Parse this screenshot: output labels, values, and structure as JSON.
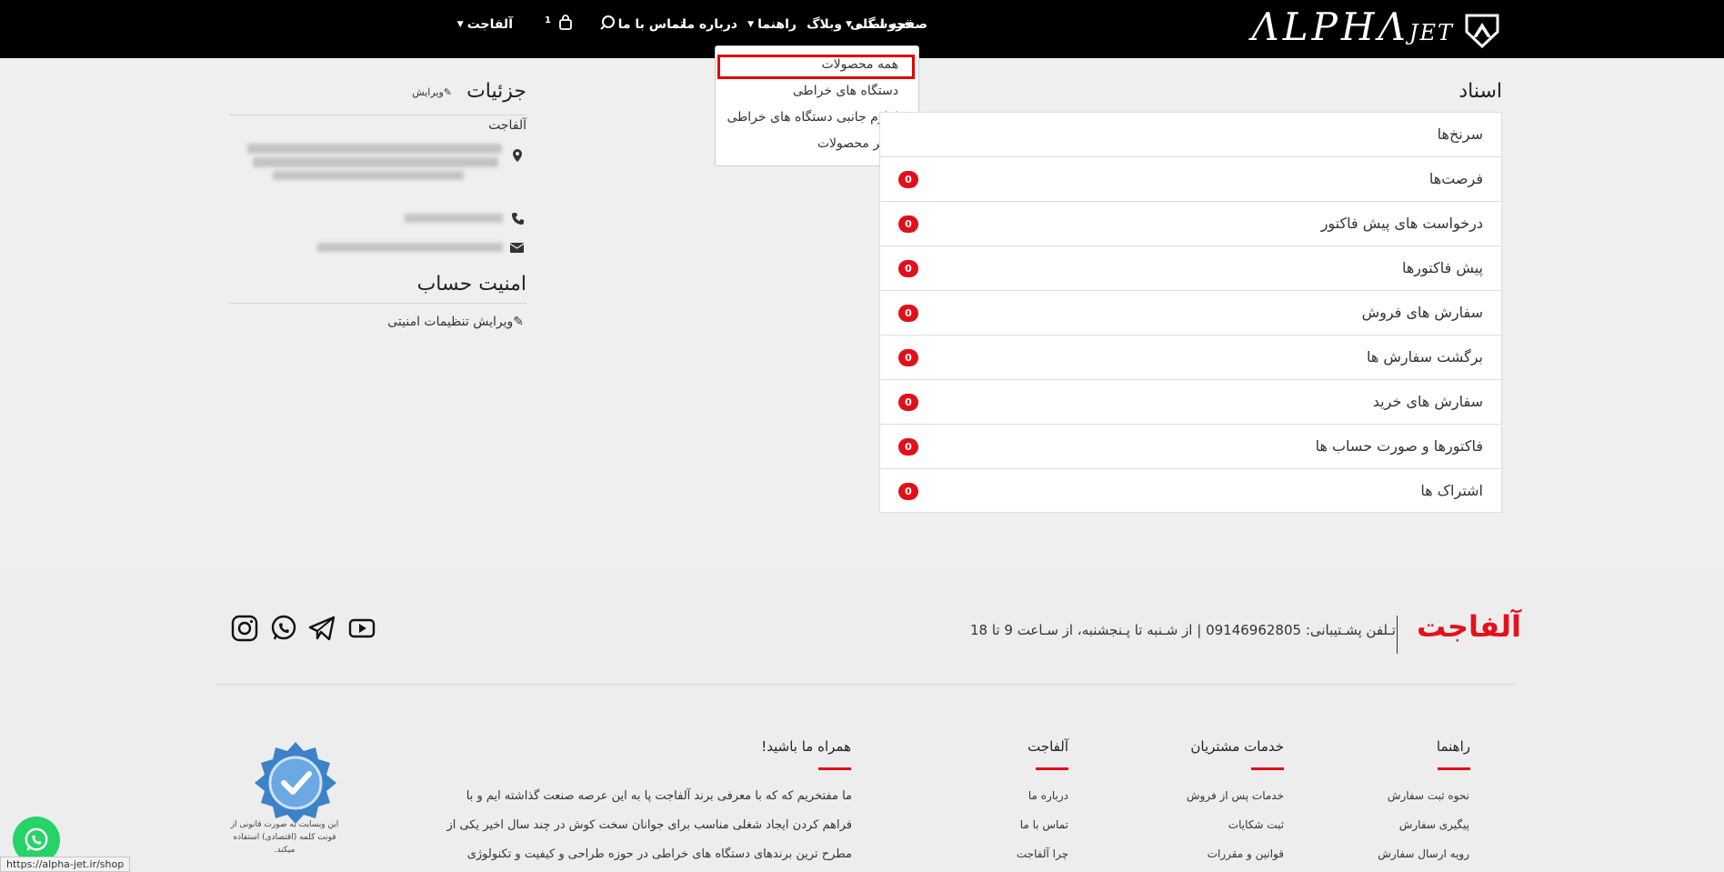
{
  "header": {
    "logo_text": "ΛLPHΛ",
    "logo_sub": "JET",
    "nav": {
      "home": "صفحه اصلی",
      "shop": "فروشگاه",
      "blog": "وبلاگ",
      "guide": "راهنما",
      "about": "درباره ما",
      "contact": "تماس با ما",
      "account": "آلفاجت"
    },
    "cart_count": "1"
  },
  "dropdown": {
    "items": [
      "همه محصولات",
      "دستگاه های خراطی",
      "لوازم جانبی دستگاه های خراطی",
      "سایر محصولات"
    ],
    "active_index": 0
  },
  "documents": {
    "title": "اسناد",
    "rows": [
      {
        "label": "سرنخ‌ها",
        "count": ""
      },
      {
        "label": "فرصت‌ها",
        "count": "0"
      },
      {
        "label": "درخواست های پیش فاکتور",
        "count": "0"
      },
      {
        "label": "پیش فاکتورها",
        "count": "0"
      },
      {
        "label": "سفارش های فروش",
        "count": "0"
      },
      {
        "label": "برگشت سفارش ها",
        "count": "0"
      },
      {
        "label": "سفارش های خرید",
        "count": "0"
      },
      {
        "label": "فاکتورها و صورت حساب ها",
        "count": "0"
      },
      {
        "label": "اشتراک ها",
        "count": "0"
      }
    ]
  },
  "details": {
    "title": "جزئیات",
    "edit_label": "ویرایش",
    "company": "آلفاجت"
  },
  "security": {
    "title": "امنیت حساب",
    "edit_label": "ویرایش تنظیمات امنیتی"
  },
  "footer": {
    "brand": "آلفاجت",
    "support_text": "تـلفن پشـتیبانی: 09146962805  |  از شـنبه تا پـنجشنبه، از سـاعت 9 تا 18",
    "columns": {
      "guide": {
        "title": "راهنما",
        "links": [
          "نحوه ثبت سفارش",
          "پیگیری سفارش",
          "رویه ارسال سفارش"
        ]
      },
      "services": {
        "title": "خدمات مشتریان",
        "links": [
          "خدمات پس از فروش",
          "ثبت شکایات",
          "قوانین و مقررات"
        ]
      },
      "alphajet": {
        "title": "آلفاجت",
        "links": [
          "درباره ما",
          "تماس با ما",
          "چرا آلفاجت"
        ]
      },
      "join": {
        "title": "همراه ما باشید!",
        "lines": [
          "ما مفتخریم که که با معرفی برند آلفاجت پا به این عرصه صنعت گذاشته ایم و با",
          "فراهم کردن ایجاد شغلی مناسب برای جوانان سخت کوش در چند سال اخیر یکی از",
          "مطرح ترین برندهای دستگاه های خراطی در حوزه طراحی و کیفیت و تکنولوژی"
        ]
      }
    },
    "font_note": "این وبسایت به صورت قانونی از فونت کلمه (اقتصادی) استفاده میکند."
  },
  "status_url": "https://alpha-jet.ir/shop",
  "colors": {
    "accent": "#e30b17",
    "badge": "#e0101a",
    "header_bg": "#000000"
  }
}
